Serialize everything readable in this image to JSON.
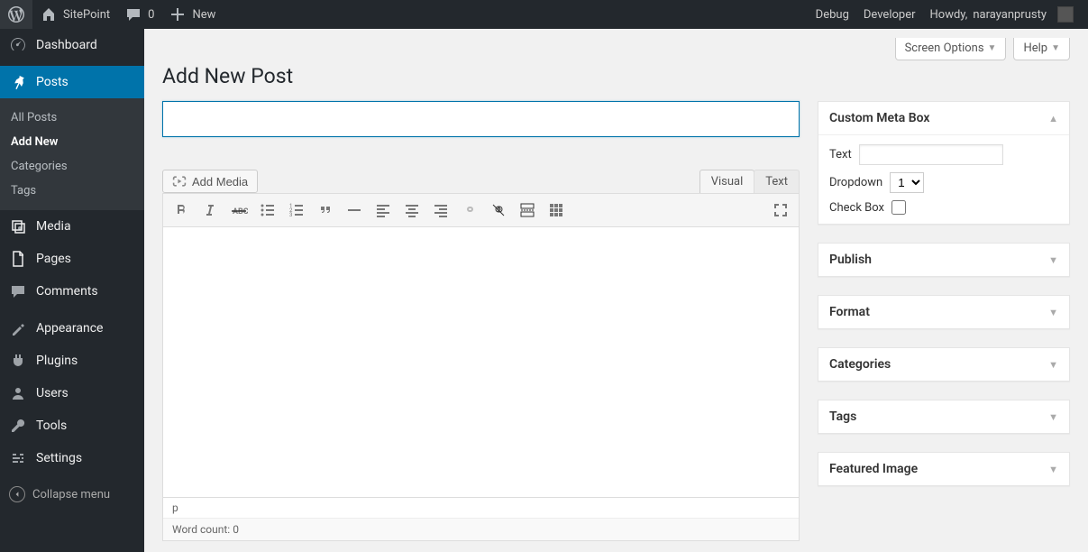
{
  "adminbar": {
    "site_name": "SitePoint",
    "comments_count": "0",
    "new_label": "New",
    "debug_label": "Debug",
    "developer_label": "Developer",
    "howdy_prefix": "Howdy,",
    "username": "narayanprusty"
  },
  "sidebar": {
    "dashboard": "Dashboard",
    "posts": "Posts",
    "posts_sub": {
      "all": "All Posts",
      "add_new": "Add New",
      "categories": "Categories",
      "tags": "Tags"
    },
    "media": "Media",
    "pages": "Pages",
    "comments": "Comments",
    "appearance": "Appearance",
    "plugins": "Plugins",
    "users": "Users",
    "tools": "Tools",
    "settings": "Settings",
    "collapse": "Collapse menu"
  },
  "top_buttons": {
    "screen_options": "Screen Options",
    "help": "Help"
  },
  "page_title": "Add New Post",
  "title_placeholder": "",
  "add_media": "Add Media",
  "editor_tabs": {
    "visual": "Visual",
    "text": "Text"
  },
  "editor_status": {
    "path": "p",
    "word_count_label": "Word count:",
    "word_count_value": "0"
  },
  "metabox": {
    "custom": {
      "title": "Custom Meta Box",
      "text_label": "Text",
      "dropdown_label": "Dropdown",
      "dropdown_value": "1",
      "checkbox_label": "Check Box"
    },
    "publish": "Publish",
    "format": "Format",
    "categories": "Categories",
    "tags": "Tags",
    "featured": "Featured Image"
  }
}
